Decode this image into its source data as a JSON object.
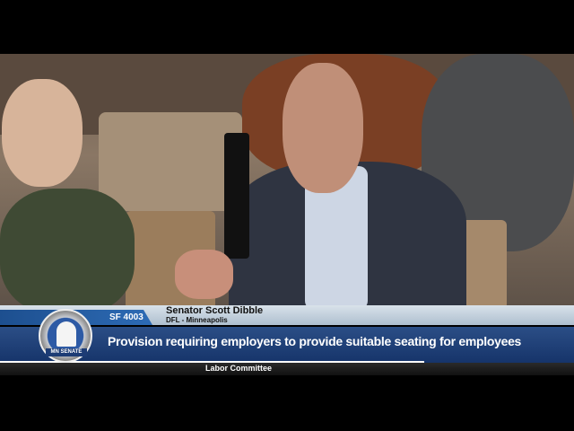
{
  "lower_third": {
    "bill": "SF 4003",
    "speaker_name": "Senator Scott Dibble",
    "speaker_party_district": "DFL - Minneapolis",
    "topic": "Provision requiring employers to provide suitable seating for employees",
    "committee": "Labor Committee",
    "logo_text": "MN SENATE"
  },
  "colors": {
    "band_blue": "#1d3c75",
    "accent_blue": "#2d6bb5",
    "light_band": "#d9e2ea"
  }
}
